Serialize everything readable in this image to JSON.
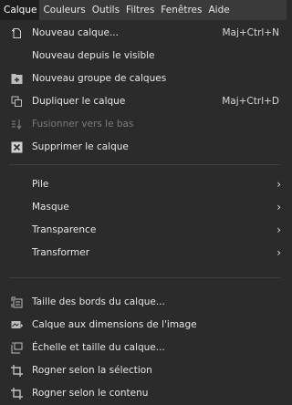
{
  "menubar": {
    "items": [
      "Calque",
      "Couleurs",
      "Outils",
      "Filtres",
      "Fenêtres",
      "Aide"
    ]
  },
  "menu": {
    "new_layer": {
      "label": "Nouveau calque...",
      "shortcut": "Maj+Ctrl+N"
    },
    "new_from_visible": {
      "label": "Nouveau depuis le visible"
    },
    "new_layer_group": {
      "label": "Nouveau groupe de calques"
    },
    "duplicate_layer": {
      "label": "Dupliquer le calque",
      "shortcut": "Maj+Ctrl+D"
    },
    "merge_down": {
      "label": "Fusionner vers le bas",
      "disabled": true
    },
    "delete_layer": {
      "label": "Supprimer le calque"
    },
    "stack": {
      "label": "Pile"
    },
    "mask": {
      "label": "Masque"
    },
    "transparency": {
      "label": "Transparence"
    },
    "transform": {
      "label": "Transformer"
    },
    "layer_boundary_size": {
      "label": "Taille des bords du calque..."
    },
    "layer_to_image_size": {
      "label": "Calque aux dimensions de l'image"
    },
    "scale_layer": {
      "label": "Échelle et taille du calque..."
    },
    "crop_to_selection": {
      "label": "Rogner selon la sélection"
    },
    "crop_to_content": {
      "label": "Rogner selon le contenu"
    }
  }
}
